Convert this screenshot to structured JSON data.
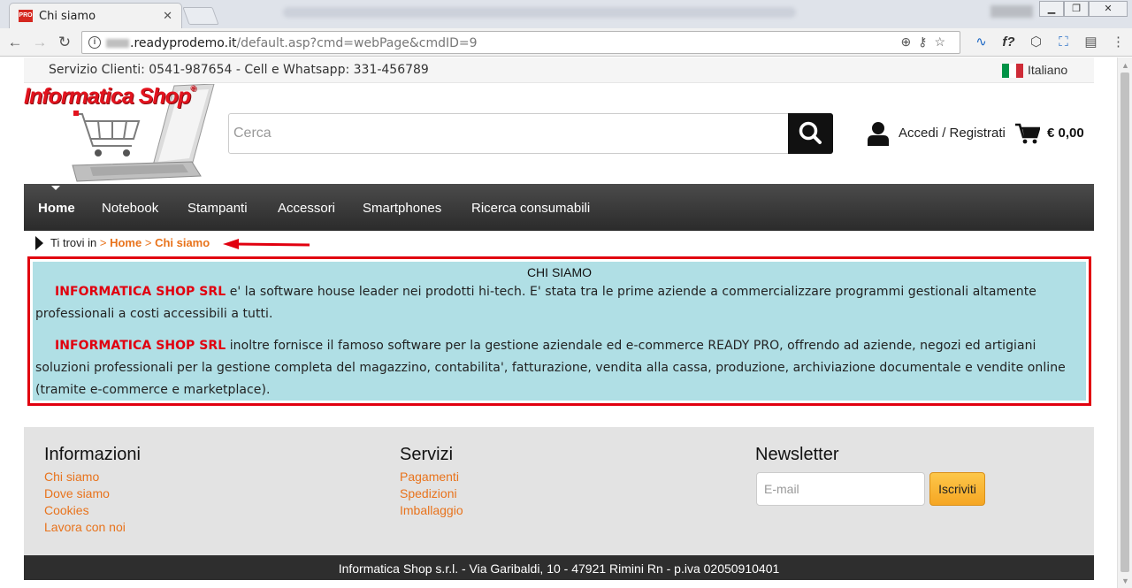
{
  "browser": {
    "tab_title": "Chi siamo",
    "tab_favicon_text": "PRO",
    "url_host": ".readyprodemo.it",
    "url_path": "/default.asp?cmd=webPage&cmdID=9"
  },
  "topbar": {
    "service": "Servizio Clienti: 0541-987654 - Cell e Whatsapp: 331-456789",
    "language": "Italiano"
  },
  "header": {
    "logo_text": "Informatica Shop",
    "logo_reg": "®",
    "search_placeholder": "Cerca",
    "login_label": "Accedi / Registrati",
    "cart_total": "€ 0,00"
  },
  "nav": {
    "items": [
      {
        "label": "Home"
      },
      {
        "label": "Notebook"
      },
      {
        "label": "Stampanti"
      },
      {
        "label": "Accessori"
      },
      {
        "label": "Smartphones"
      },
      {
        "label": "Ricerca consumabili"
      }
    ]
  },
  "breadcrumb": {
    "prefix": "Ti trovi in",
    "sep": ">",
    "home": "Home",
    "current": "Chi siamo"
  },
  "content": {
    "title": "CHI SIAMO",
    "brand": "INFORMATICA SHOP SRL",
    "para1": " e' la software house leader nei prodotti hi-tech. E' stata tra le prime aziende a commercializzare programmi gestionali altamente professionali a costi accessibili a tutti.",
    "para2": " inoltre fornisce il famoso software per la gestione aziendale ed e-commerce READY PRO, offrendo ad aziende, negozi ed artigiani soluzioni professionali per la gestione completa del magazzino, contabilita', fatturazione, vendita alla cassa, produzione, archiviazione documentale e vendite online (tramite e-commerce e marketplace)."
  },
  "footer": {
    "info_title": "Informazioni",
    "info_links": [
      "Chi siamo",
      "Dove siamo",
      "Cookies",
      "Lavora con noi"
    ],
    "services_title": "Servizi",
    "services_links": [
      "Pagamenti",
      "Spedizioni",
      "Imballaggio"
    ],
    "newsletter_title": "Newsletter",
    "email_placeholder": "E-mail",
    "subscribe_label": "Iscriviti",
    "address": "Informatica Shop s.r.l. - Via Garibaldi, 10 - 47921 Rimini Rn - p.iva 02050910401"
  },
  "colors": {
    "accent_orange": "#e8731c",
    "brand_red": "#e1000f",
    "content_bg": "#b0dfe5",
    "nav_bg": "#333333"
  }
}
